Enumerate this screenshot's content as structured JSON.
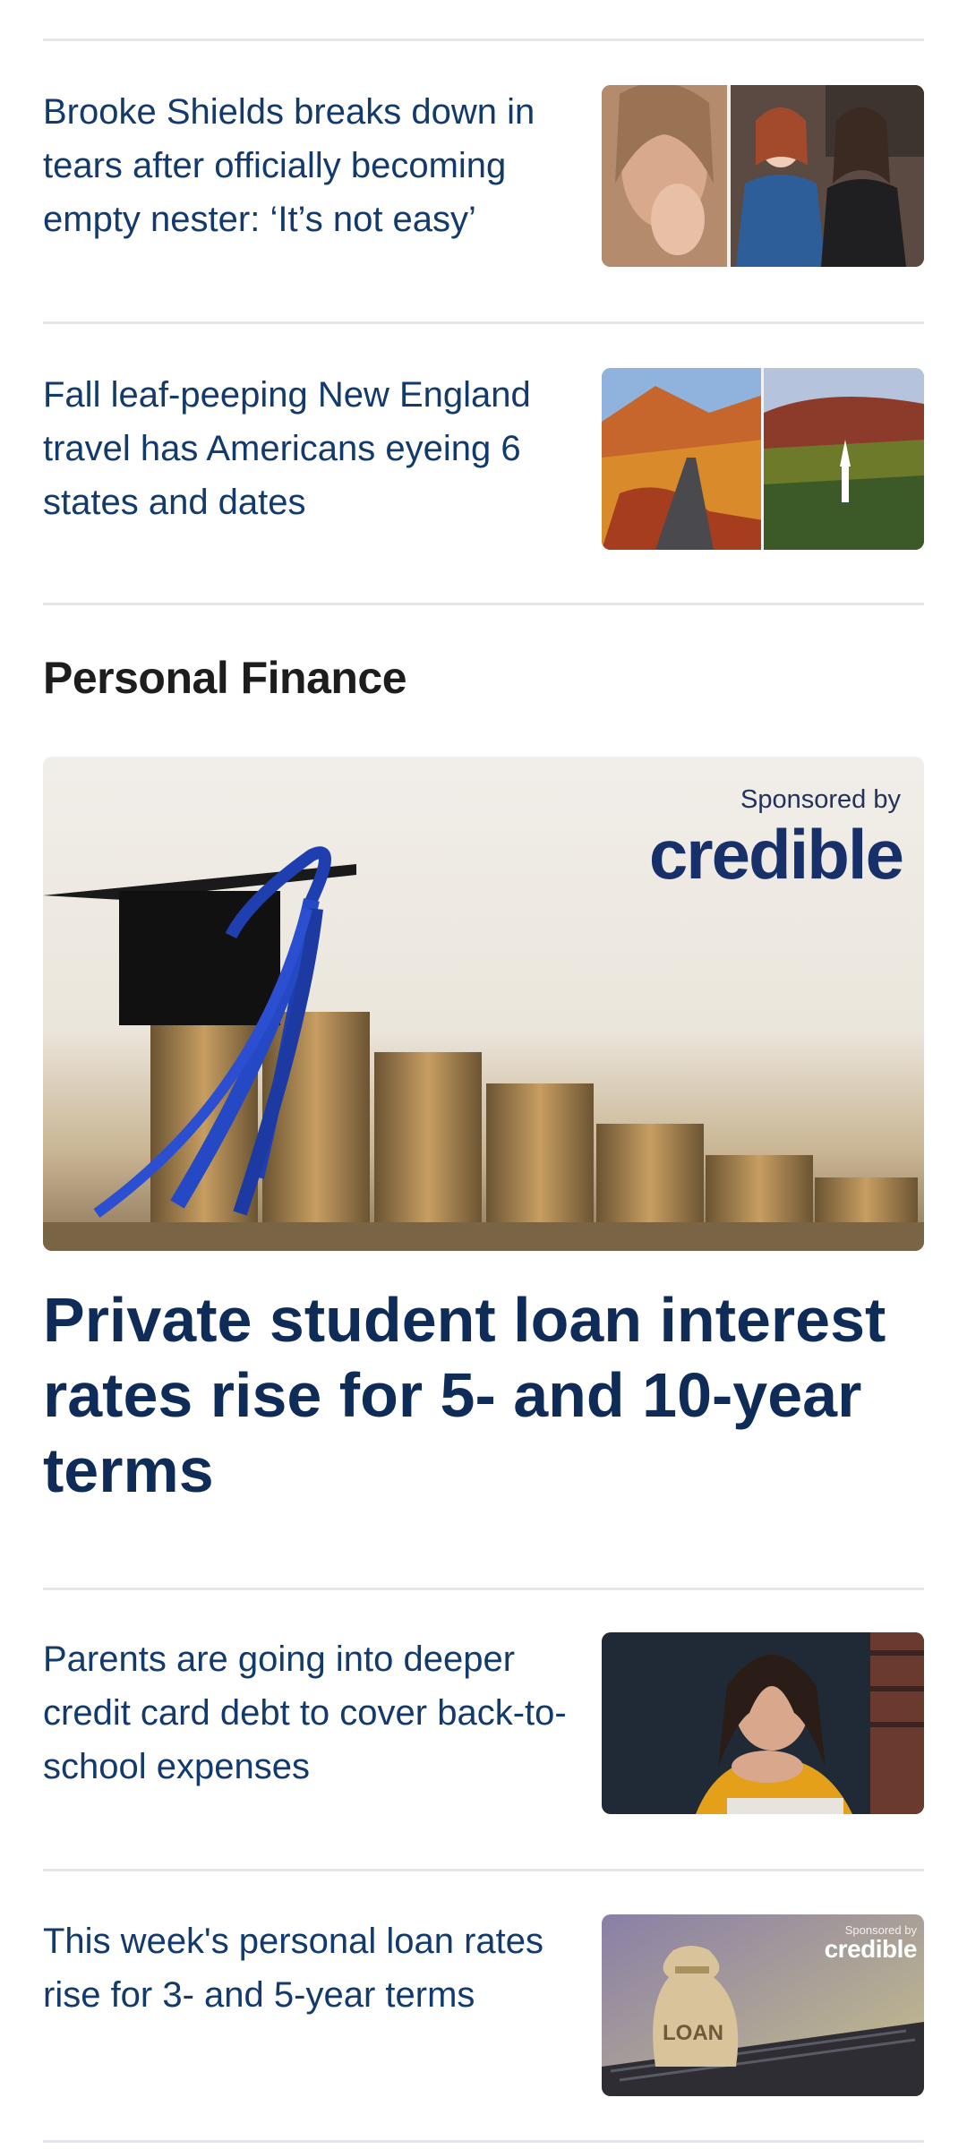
{
  "stories_top": [
    {
      "title": "Brooke Shields breaks down in tears after officially becoming empty nester: ‘It’s not easy’",
      "image": "brooke-shields-photo"
    },
    {
      "title": "Fall leaf-peeping New England travel has Americans eyeing 6 states and dates",
      "image": "fall-foliage-photo"
    }
  ],
  "section": {
    "heading": "Personal Finance",
    "hero": {
      "sponsor_label": "Sponsored by",
      "sponsor_brand": "credible",
      "title": "Private student loan interest rates rise for 5- and 10-year terms",
      "image": "graduation-cap-coins-photo"
    },
    "stories": [
      {
        "title": "Parents are going into deeper credit card debt to cover back-to-school expenses",
        "image": "worried-parent-photo"
      },
      {
        "title": "This week's personal loan rates rise for 3- and 5-year terms",
        "image": "loan-bag-laptop-photo",
        "sponsor_label": "Sponsored by",
        "sponsor_brand": "credible",
        "bag_text": "LOAN"
      }
    ]
  },
  "colors": {
    "headline": "#123a6c",
    "divider": "#e3e6ea",
    "heading": "#1d1d1d",
    "brand": "#17306a"
  }
}
